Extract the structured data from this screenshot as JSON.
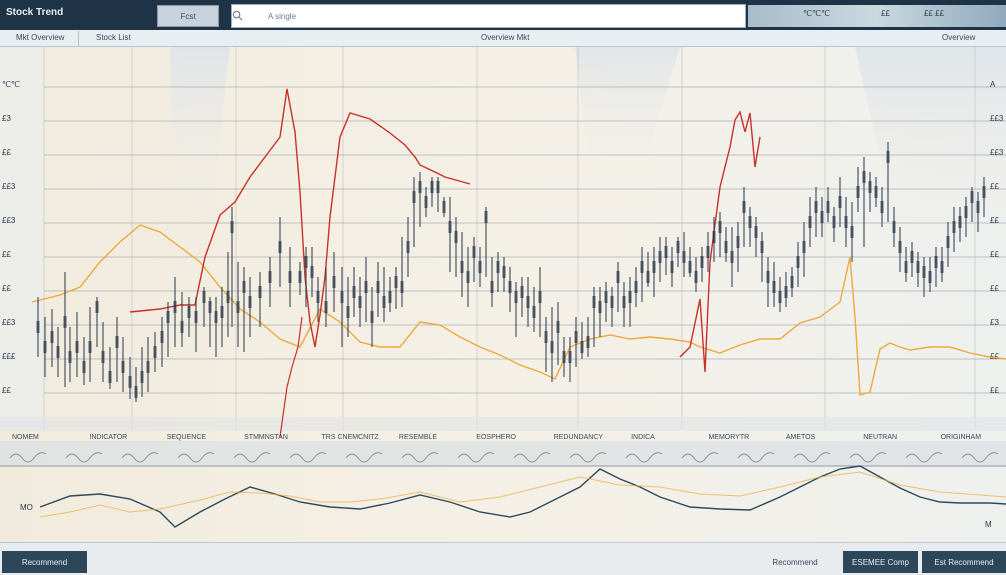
{
  "app": {
    "title": "Stock Trend"
  },
  "topbar": {
    "tab_label": "Fcst",
    "search_placeholder": "A single",
    "right_buttons": [
      "℃℃℃",
      "££",
      "££ ££"
    ]
  },
  "toolbar": {
    "items": [
      "Mkt Overview",
      "Stock List",
      "Overview Mkt",
      "Overview"
    ]
  },
  "chart": {
    "y_labels": [
      "℃℃",
      "£3",
      "££",
      "££3",
      "££3",
      "££",
      "££",
      "££3",
      "£££",
      "££"
    ],
    "y_labels_right": [
      "A",
      "££3",
      "££3",
      "££",
      "££",
      "££",
      "££",
      "£3",
      "££",
      "££"
    ],
    "x_labels": [
      "NOMEM",
      "INDICATOR",
      "SEQUENCE",
      "STMMNSTAN",
      "TRS CNEMCNITZ",
      "RESEMBLE",
      "EOSPHERO",
      "REDUNDANCY",
      "INDICA",
      "MEMORYTR",
      "AMETOS",
      "NEUTRAN",
      "ORIGINHAM"
    ],
    "indicator_label_left": "MO",
    "indicator_label_right": "M"
  },
  "colors": {
    "topbar": "#1f3347",
    "candle": "#2d3b4c",
    "ma_red": "#c8312a",
    "ma_orange": "#eda93a",
    "oscillator": "#2a4a5c"
  },
  "bottombar": {
    "left_button": "Recommend",
    "center_label": "Recommend",
    "right_buttons": [
      "ESEMEE Comp",
      "Est Recommend"
    ]
  }
}
